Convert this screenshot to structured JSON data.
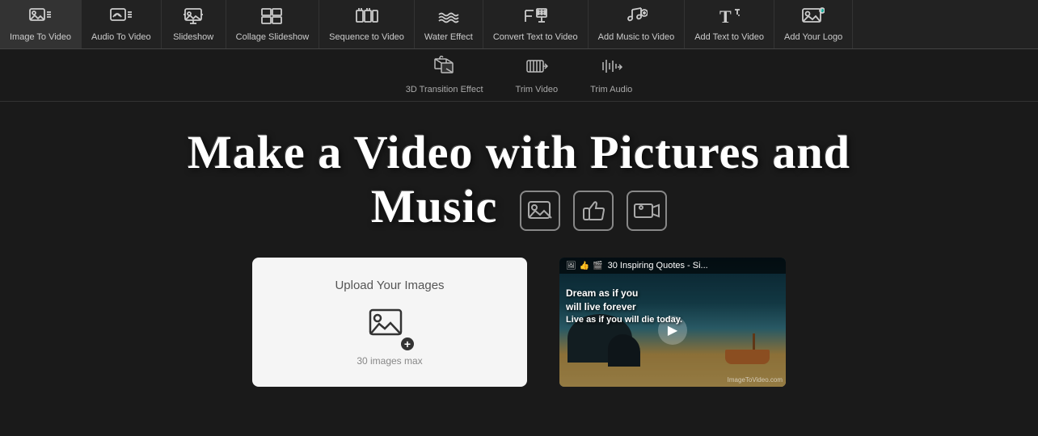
{
  "nav": {
    "items": [
      {
        "id": "image-to-video",
        "label": "Image To Video",
        "icon": "🖼"
      },
      {
        "id": "audio-to-video",
        "label": "Audio To Video",
        "icon": "🎵"
      },
      {
        "id": "slideshow",
        "label": "Slideshow",
        "icon": "📋"
      },
      {
        "id": "collage-slideshow",
        "label": "Collage Slideshow",
        "icon": "🎞"
      },
      {
        "id": "sequence-to-video",
        "label": "Sequence to Video",
        "icon": "🎬"
      },
      {
        "id": "water-effect",
        "label": "Water Effect",
        "icon": "〰"
      },
      {
        "id": "convert-text-to-video",
        "label": "Convert Text to Video",
        "icon": "📝"
      },
      {
        "id": "add-music-to-video",
        "label": "Add Music to Video",
        "icon": "🎤"
      },
      {
        "id": "add-text-to-video",
        "label": "Add Text to Video",
        "icon": "T"
      },
      {
        "id": "add-your-logo",
        "label": "Add Your Logo",
        "icon": "🖼"
      }
    ]
  },
  "secondary_nav": {
    "items": [
      {
        "id": "3d-transition",
        "label": "3D Transition Effect",
        "icon": "✦"
      },
      {
        "id": "trim-video",
        "label": "Trim Video",
        "icon": "✂"
      },
      {
        "id": "trim-audio",
        "label": "Trim Audio",
        "icon": "✂"
      }
    ]
  },
  "hero": {
    "title_line1": "Make a Video with Pictures and",
    "title_line2": "Music"
  },
  "upload": {
    "label": "Upload Your Images",
    "hint": "30 images max"
  },
  "video_preview": {
    "title": "30 Inspiring Quotes - Si...",
    "quote_line1": "Dream as if you",
    "quote_line2": "will live forever",
    "quote_line3": "Live as if you will die today.",
    "watermark": "ImageToVideo.com"
  }
}
